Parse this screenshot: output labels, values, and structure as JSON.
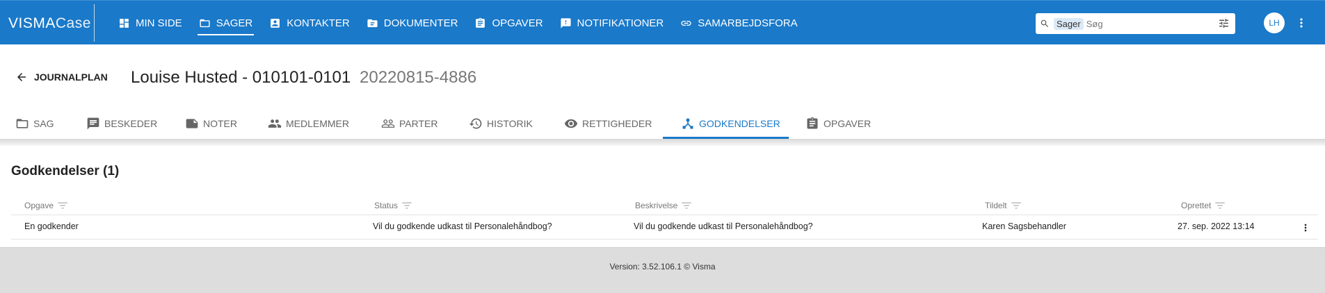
{
  "app": {
    "logo_bold": "VISMA",
    "logo_light": "Case"
  },
  "nav": {
    "items": [
      {
        "label": "MIN SIDE",
        "icon": "dashboard-icon"
      },
      {
        "label": "SAGER",
        "icon": "folder-icon",
        "active": true
      },
      {
        "label": "KONTAKTER",
        "icon": "contact-card-icon"
      },
      {
        "label": "DOKUMENTER",
        "icon": "document-folder-icon"
      },
      {
        "label": "OPGAVER",
        "icon": "clipboard-icon"
      },
      {
        "label": "NOTIFIKATIONER",
        "icon": "notification-icon"
      },
      {
        "label": "SAMARBEJDSFORA",
        "icon": "link-icon"
      }
    ]
  },
  "search": {
    "scope": "Sager",
    "placeholder": "Søg",
    "value": ""
  },
  "user": {
    "initials": "LH"
  },
  "header": {
    "back_label": "JOURNALPLAN",
    "title": "Louise Husted - 010101-0101",
    "case_number": "20220815-4886"
  },
  "tabs": [
    {
      "label": "SAG",
      "icon": "folder-icon"
    },
    {
      "label": "BESKEDER",
      "icon": "message-icon"
    },
    {
      "label": "NOTER",
      "icon": "note-icon"
    },
    {
      "label": "MEDLEMMER",
      "icon": "people-icon"
    },
    {
      "label": "PARTER",
      "icon": "people-outline-icon"
    },
    {
      "label": "HISTORIK",
      "icon": "history-icon"
    },
    {
      "label": "RETTIGHEDER",
      "icon": "eye-icon"
    },
    {
      "label": "GODKENDELSER",
      "icon": "approval-icon",
      "active": true
    },
    {
      "label": "OPGAVER",
      "icon": "clipboard-icon"
    }
  ],
  "section": {
    "title": "Godkendelser (1)"
  },
  "table": {
    "columns": [
      "Opgave",
      "Status",
      "Beskrivelse",
      "Tildelt",
      "Oprettet"
    ],
    "rows": [
      {
        "opgave": "En godkender",
        "status": "Vil du godkende udkast til Personalehåndbog?",
        "beskrivelse": "Vil du godkende udkast til Personalehåndbog?",
        "tildelt": "Karen Sagsbehandler",
        "oprettet": "27. sep. 2022 13:14"
      }
    ]
  },
  "footer": {
    "text": "Version: 3.52.106.1   © Visma"
  },
  "colors": {
    "brand": "#1a79c8",
    "footer_bg": "#dddddd"
  }
}
